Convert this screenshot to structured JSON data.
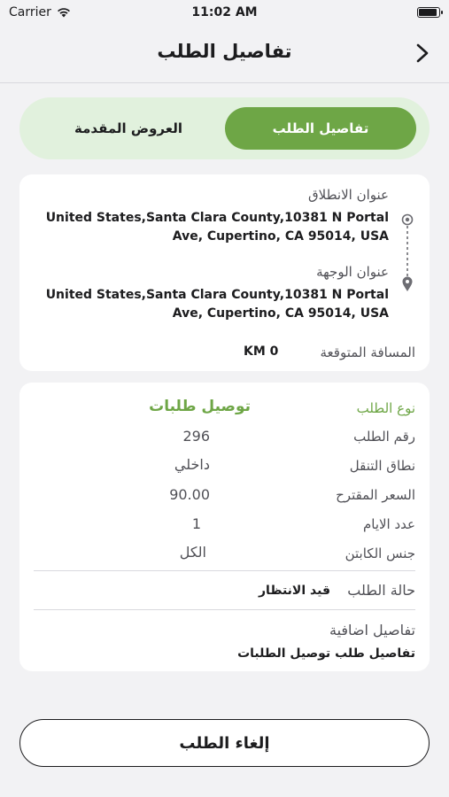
{
  "status_bar": {
    "carrier": "Carrier",
    "time": "11:02 AM",
    "wifi_icon": "wifi-icon",
    "battery_icon": "battery-icon"
  },
  "nav": {
    "title": "تفاصيل الطلب",
    "back_icon": "chevron-right-icon"
  },
  "tabs": [
    {
      "label": "تفاصيل الطلب",
      "active": true
    },
    {
      "label": "العروض المقدمة",
      "active": false
    }
  ],
  "route": {
    "pickup_label": "عنوان الانطلاق",
    "pickup_address": "United States,Santa Clara County,10381 N Portal Ave, Cupertino, CA 95014, USA",
    "dropoff_label": "عنوان الوجهة",
    "dropoff_address": "United States,Santa Clara County,10381 N Portal Ave, Cupertino, CA 95014, USA",
    "distance_label": "المسافة المتوقعة",
    "distance_value": "KM 0"
  },
  "details": {
    "rows": [
      {
        "label": "نوع الطلب",
        "value": "توصيل طلبات"
      },
      {
        "label": "رقم الطلب",
        "value": "296"
      },
      {
        "label": "نطاق التنقل",
        "value": "داخلي"
      },
      {
        "label": "السعر المقترح",
        "value": "90.00"
      },
      {
        "label": "عدد الايام",
        "value": "1"
      },
      {
        "label": "جنس الكابتن",
        "value": "الكل"
      }
    ],
    "status_label": "حالة الطلب",
    "status_value": "قيد الانتظار",
    "extra_label": "تفاصيل اضافية",
    "extra_value": "تفاصيل طلب توصيل الطلبات"
  },
  "cancel_button": "إلغاء الطلب",
  "colors": {
    "accent": "#6ea646",
    "tab_bg": "#e1f1dd",
    "page_bg": "#f2f2f4"
  }
}
